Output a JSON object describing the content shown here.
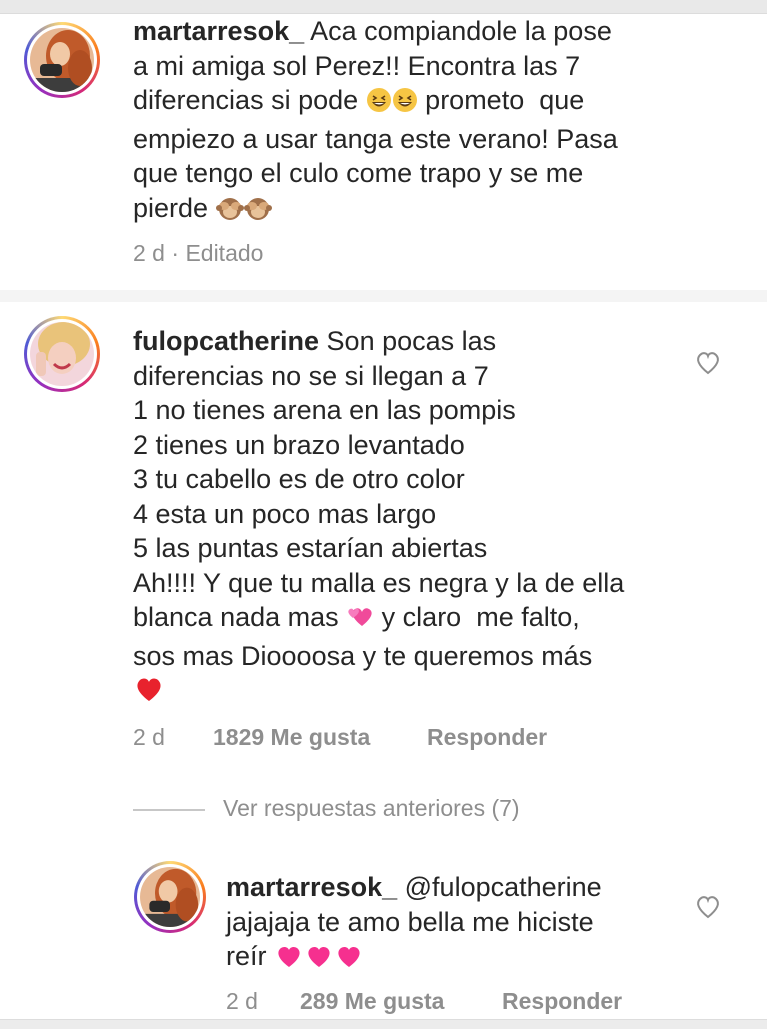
{
  "comments": [
    {
      "username": "martarresok_",
      "lines": [
        "Aca compiandole la pose",
        "a mi amiga sol Perez!! Encontra las 7",
        "diferencias si pode",
        "empiezo a usar tanga este verano! Pasa",
        "que tengo el culo come trapo y se me",
        "pierde"
      ],
      "line3_tail": "prometo  que",
      "time": "2 d",
      "edited": "Editado",
      "emojis": [
        "grinning-squint-emoji",
        "see-no-evil-monkey-emoji"
      ]
    },
    {
      "username": "fulopcatherine",
      "lines": [
        "Son pocas las",
        "diferencias no se si llegan a 7",
        "1 no tienes arena en las pompis",
        "2 tienes un brazo levantado",
        "3 tu cabello es de otro color",
        "4 esta un poco mas largo",
        "5 las puntas estarían abiertas",
        "Ah!!!! Y que tu malla es negra y la de ella",
        "blanca nada mas",
        "sos mas Dioooosa y te queremos más"
      ],
      "line9_tail": "y claro  me falto,",
      "time": "2 d",
      "likes": "1829 Me gusta",
      "reply": "Responder",
      "emojis": [
        "two-hearts-emoji",
        "red-heart-emoji"
      ]
    }
  ],
  "view_replies": "Ver respuestas anteriores (7)",
  "reply": {
    "username": "martarresok_",
    "mention": "@fulopcatherine",
    "lines": [
      "jajajaja te amo bella me hiciste",
      "reír"
    ],
    "time": "2 d",
    "likes": "289 Me gusta",
    "reply_label": "Responder",
    "emojis": [
      "pink-heart-emoji"
    ]
  },
  "colors": {
    "text": "#262626",
    "secondary": "#8e8e8e",
    "mention": "#262626",
    "story_ring": [
      "#feda75",
      "#fa7e1e",
      "#d62976",
      "#962fbf",
      "#4f5bd5"
    ]
  }
}
